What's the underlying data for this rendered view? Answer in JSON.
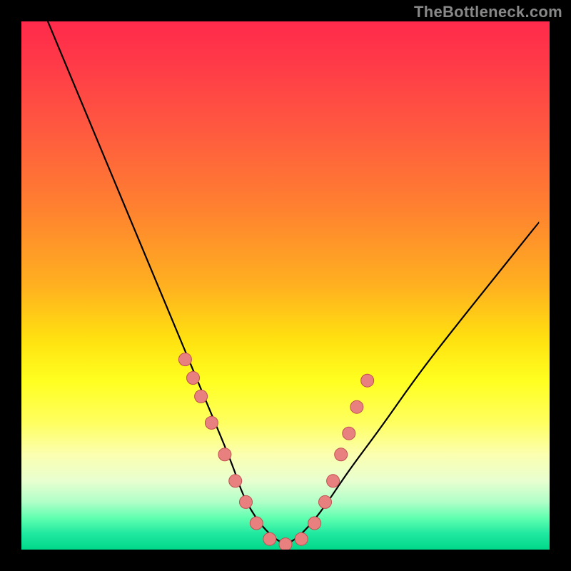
{
  "watermark": "TheBottleneck.com",
  "chart_data": {
    "type": "line",
    "title": "",
    "xlabel": "",
    "ylabel": "",
    "xlim": [
      0,
      100
    ],
    "ylim": [
      0,
      100
    ],
    "series": [
      {
        "name": "bottleneck-curve",
        "x": [
          5,
          10,
          15,
          20,
          25,
          30,
          35,
          40,
          42,
          45,
          48,
          50,
          52,
          55,
          58,
          62,
          68,
          75,
          82,
          90,
          98
        ],
        "y": [
          100,
          88,
          76,
          64,
          52,
          40,
          28,
          16,
          10,
          5,
          2,
          1,
          2,
          5,
          9,
          15,
          23,
          33,
          42,
          52,
          62
        ]
      }
    ],
    "markers": {
      "name": "highlight-points",
      "x": [
        31,
        32.5,
        34,
        36,
        38.5,
        40.5,
        42.5,
        44.5,
        47,
        50,
        53,
        55.5,
        57.5,
        59,
        60.5,
        62,
        63.5,
        65.5
      ],
      "y": [
        36,
        32.5,
        29,
        24,
        18,
        13,
        9,
        5,
        2,
        1,
        2,
        5,
        9,
        13,
        18,
        22,
        27,
        32
      ]
    },
    "colors": {
      "curve": "#000000",
      "marker_fill": "#e88080",
      "marker_stroke": "#c05050"
    }
  }
}
